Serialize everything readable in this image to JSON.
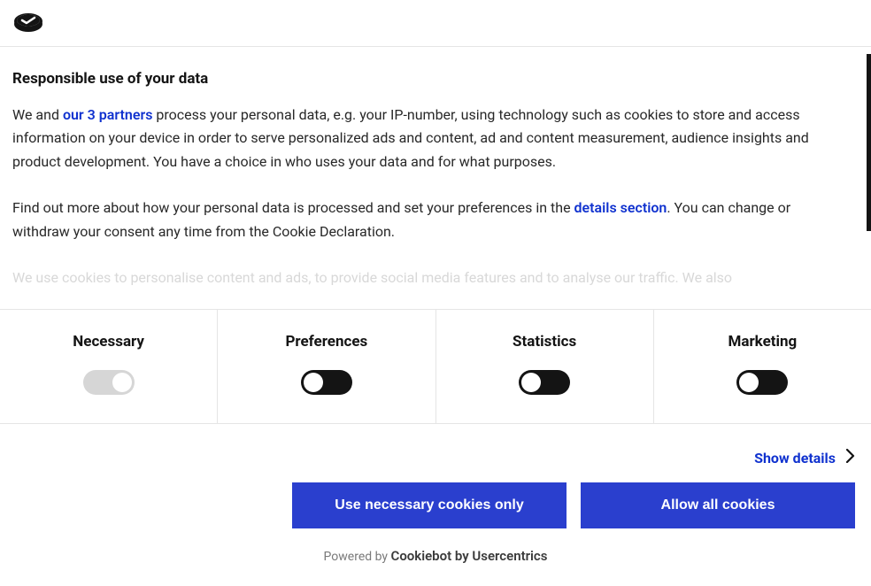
{
  "header": {
    "logo_name": "cookiebot-logo"
  },
  "content": {
    "title": "Responsible use of your data",
    "p1_pre": "We and ",
    "p1_link": "our 3 partners",
    "p1_post": " process your personal data, e.g. your IP-number, using technology such as cookies to store and access information on your device in order to serve personalized ads and content, ad and content measurement, audience insights and product development. You have a choice in who uses your data and for what purposes.",
    "p2_pre": "Find out more about how your personal data is processed and set your preferences in the ",
    "p2_link": "details section",
    "p2_post": ". You can change or withdraw your consent any time from the Cookie Declaration.",
    "p3_faded": "We use cookies to personalise content and ads, to provide social media features and to analyse our traffic. We also"
  },
  "categories": [
    {
      "label": "Necessary",
      "state": "disabled"
    },
    {
      "label": "Preferences",
      "state": "off"
    },
    {
      "label": "Statistics",
      "state": "off"
    },
    {
      "label": "Marketing",
      "state": "off"
    }
  ],
  "details": {
    "show_label": "Show details"
  },
  "buttons": {
    "necessary": "Use necessary cookies only",
    "allow": "Allow all cookies"
  },
  "footer": {
    "powered_prefix": "Powered by ",
    "brand": "Cookiebot by Usercentrics"
  }
}
